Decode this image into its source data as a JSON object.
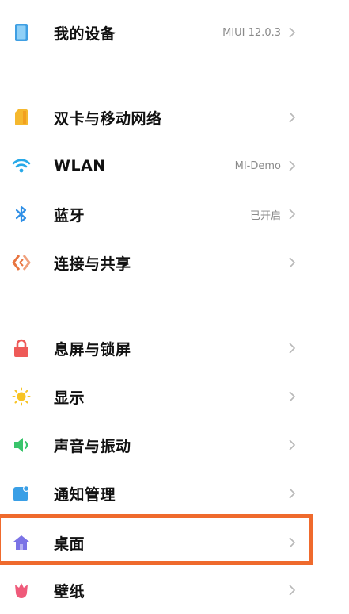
{
  "items": [
    {
      "label": "我的设备",
      "value": "MIUI 12.0.3",
      "icon": "device-icon"
    },
    {
      "label": "双卡与移动网络",
      "value": "",
      "icon": "sim-card-icon"
    },
    {
      "label": "WLAN",
      "value": "MI-Demo",
      "icon": "wifi-icon"
    },
    {
      "label": "蓝牙",
      "value": "已开启",
      "icon": "bluetooth-icon"
    },
    {
      "label": "连接与共享",
      "value": "",
      "icon": "share-icon"
    },
    {
      "label": "息屏与锁屏",
      "value": "",
      "icon": "lock-icon"
    },
    {
      "label": "显示",
      "value": "",
      "icon": "sun-icon"
    },
    {
      "label": "声音与振动",
      "value": "",
      "icon": "speaker-icon"
    },
    {
      "label": "通知管理",
      "value": "",
      "icon": "notification-icon"
    },
    {
      "label": "桌面",
      "value": "",
      "icon": "home-icon"
    },
    {
      "label": "壁纸",
      "value": "",
      "icon": "wallpaper-icon"
    }
  ],
  "colors": {
    "highlight": "#ef6a2d",
    "device": "#3f9fe3",
    "sim": "#f5b82e",
    "wifi": "#28a9e8",
    "bluetooth": "#2f8fe6",
    "share": "#e8743f",
    "lock": "#ee5a58",
    "sun": "#f7c324",
    "sound": "#39c46b",
    "notification": "#3a9fe6",
    "home": "#7b73e6",
    "wallpaper": "#ef5a7a"
  }
}
